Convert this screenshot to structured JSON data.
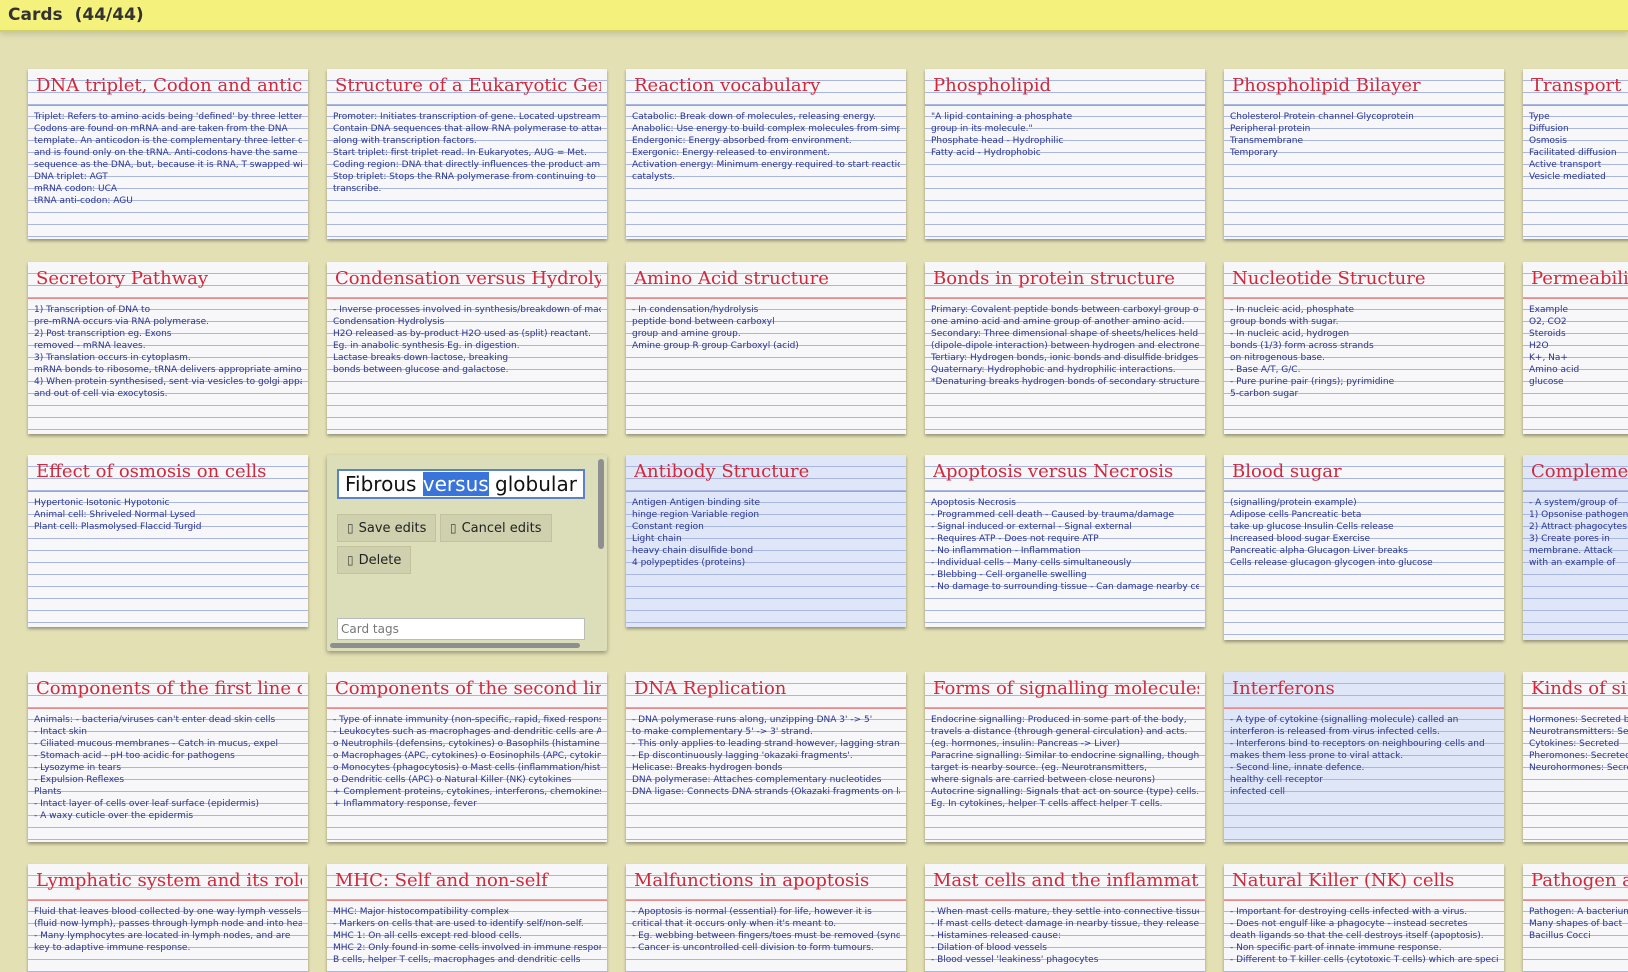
{
  "header": {
    "title": "Cards",
    "count": "(44/44)"
  },
  "editor": {
    "text_before": "Fibrous ",
    "text_selected": "versus",
    "text_after": " globular pro",
    "save_label": "Save edits",
    "cancel_label": "Cancel edits",
    "delete_label": "Delete",
    "tags_placeholder": "Card tags"
  },
  "cards": [
    {
      "title": "DNA triplet, Codon and anticodon",
      "lines": [
        "Triplet: Refers to amino acids being 'defined' by three letters.",
        "Codons are found on mRNA and are taken from the DNA",
        "template. An anticodon is the complementary three letter code",
        "and is found only on the tRNA. Anti-codons have the same",
        "sequence as the DNA, but, because it is RNA, T swapped with U.",
        "DNA triplet: AGT",
        "mRNA codon: UCA",
        "tRNA anti-codon: AGU"
      ]
    },
    {
      "title": "Structure of a Eukaryotic Gene",
      "lines": [
        "Promoter: Initiates transcription of gene. Located upstream.",
        "Contain DNA sequences that allow RNA polymerase to attach,",
        "along with transcription factors.",
        "Start triplet: first triplet read. In Eukaryotes, AUG = Met.",
        "Coding region: DNA that directly influences the product amino acids.",
        "Stop triplet: Stops the RNA polymerase from continuing to",
        "transcribe."
      ]
    },
    {
      "title": "Reaction vocabulary",
      "lines": [
        "Catabolic: Break down of molecules, releasing energy.",
        "Anabolic: Use energy to build complex molecules from simpler components.",
        "Endergonic: Energy absorbed from environment.",
        "Exergonic: Energy released to environment.",
        "Activation energy: Minimum energy required to start reaction. Lowered with",
        "catalysts."
      ]
    },
    {
      "title": "Phospholipid",
      "lines": [
        "\"A lipid containing a phosphate",
        "group in its molecule.\"",
        "Phosphate head - Hydrophilic",
        "Fatty acid - Hydrophobic"
      ]
    },
    {
      "title": "Phospholipid Bilayer",
      "lines": [
        "Cholesterol   Protein channel   Glycoprotein",
        "Peripheral protein",
        "Transmembrane",
        "Temporary"
      ]
    },
    {
      "title": "Transport across",
      "lines": [
        "Type",
        "Diffusion",
        "Osmosis",
        "Facilitated diffusion",
        "Active transport",
        "Vesicle mediated"
      ]
    },
    {
      "title": "Secretory Pathway",
      "lines": [
        "1) Transcription of DNA to",
        "pre-mRNA occurs via RNA polymerase.",
        "2) Post transcription eg. Exons",
        "removed - mRNA leaves.",
        "3) Translation occurs in cytoplasm.",
        "mRNA bonds to ribosome, tRNA delivers appropriate amino acids.",
        "4) When protein synthesised, sent via vesicles to golgi apparatus",
        "and out of cell via exocytosis."
      ]
    },
    {
      "title": "Condensation versus Hydrolysis",
      "lines": [
        "- Inverse processes involved in synthesis/breakdown of macromolecules.",
        "Condensation        Hydrolysis",
        "H2O released as by-product   H2O used as (split) reactant.",
        "Eg. in anabolic synthesis   Eg. in digestion.",
        "Lactase breaks down lactose, breaking",
        "bonds between glucose and galactose."
      ]
    },
    {
      "title": "Amino Acid structure",
      "lines": [
        "- In condensation/hydrolysis",
        "peptide bond between carboxyl",
        "group and amine group.",
        "Amine group   R group   Carboxyl (acid)"
      ]
    },
    {
      "title": "Bonds in protein structure",
      "lines": [
        "Primary: Covalent peptide bonds between carboxyl group of",
        "one amino acid and amine group of another amino acid.",
        "Secondary: Three dimensional shape of sheets/helices held by hydrogen bonds",
        "(dipole-dipole interaction) between hydrogen and electronegative atoms.",
        "Tertiary: Hydrogen bonds, ionic bonds and disulfide bridges.",
        "Quaternary: Hydrophobic and hydrophilic interactions.",
        "*Denaturing breaks hydrogen bonds of secondary structure."
      ]
    },
    {
      "title": "Nucleotide Structure",
      "lines": [
        "- In nucleic acid, phosphate",
        "group bonds with sugar.",
        "- In nucleic acid, hydrogen",
        "bonds (1/3) form across strands",
        "on nitrogenous base.",
        "- Base A/T, G/C.",
        "- Pure purine pair (rings); pyrimidine",
        "5-carbon sugar"
      ]
    },
    {
      "title": "Permeability of",
      "lines": [
        "Example",
        "O2, CO2",
        "Steroids",
        "H2O",
        "K+, Na+",
        "Amino acid",
        "glucose"
      ]
    },
    {
      "title": "Effect of osmosis on cells",
      "lines": [
        "Hypertonic      Isotonic      Hypotonic",
        "Animal cell: Shriveled   Normal   Lysed",
        "Plant cell: Plasmolysed   Flaccid   Turgid"
      ]
    },
    {
      "title": "Antibody Structure",
      "lines": [
        "Antigen     Antigen binding site",
        "hinge region     Variable region",
        "Constant region",
        "Light chain",
        "heavy chain     disulfide bond",
        "4 polypeptides (proteins)"
      ]
    },
    {
      "title": "Apoptosis versus Necrosis",
      "lines": [
        "Apoptosis           Necrosis",
        "- Programmed cell death   - Caused by trauma/damage",
        "- Signal induced or external   - Signal external",
        "- Requires ATP   - Does not require ATP",
        "- No inflammation   - Inflammation",
        "- Individual cells   - Many cells simultaneously",
        "- Blebbing   - Cell organelle swelling",
        "- No damage to surrounding tissue   - Can damage nearby cells"
      ]
    },
    {
      "title": "Blood sugar",
      "lines": [
        "(signalling/protein example)",
        "Adipose cells       Pancreatic beta",
        "take up glucose   Insulin   Cells release",
        "Increased blood sugar       Exercise",
        "Pancreatic alpha  Glucagon  Liver breaks",
        "Cells release glucagon  glycogen into glucose"
      ]
    },
    {
      "title": "Complement",
      "lines": [
        "- A system/group of",
        "1) Opsonise pathogen",
        "2) Attract phagocytes",
        "3) Create pores in",
        "membrane. Attack",
        "with an example of"
      ]
    },
    {
      "title": "Components of the first line of defence",
      "lines": [
        "Animals:   - bacteria/viruses can't enter dead skin cells",
        "- Intact skin",
        "- Ciliated mucous membranes - Catch in mucus, expel",
        "- Stomach acid - pH too acidic for pathogens",
        "- Lysozyme in tears",
        "- Expulsion Reflexes",
        "Plants",
        "- Intact layer of cells over leaf surface (epidermis)",
        "- A waxy cuticle over the epidermis"
      ]
    },
    {
      "title": "Components of the second line of defence",
      "lines": [
        "- Type of innate immunity (non-specific, rapid, fixed response, no mem)",
        "- Leukocytes such as macrophages and dendritic cells are APCs.",
        "o Neutrophils (defensins, cytokines)  o Basophils (histamine release)",
        "o Macrophages (APC, cytokines)   o Eosinophils (APC, cytokines)",
        "o Monocytes (phagocytosis)   o Mast cells (inflammation/histamine)",
        "o Dendritic cells (APC)   o Natural Killer (NK) cytokines",
        "+ Complement proteins, cytokines, interferons, chemokines",
        "+ Inflammatory response, fever"
      ]
    },
    {
      "title": "DNA Replication",
      "lines": [
        "- DNA polymerase runs along, unzipping DNA 3' -> 5'",
        "to make complementary 5' -> 3' strand.",
        "- This only applies to leading strand however, lagging strand",
        "- Ep discontinuously lagging 'okazaki fragments'.",
        "Helicase: Breaks hydrogen bonds",
        "DNA polymerase: Attaches complementary nucleotides",
        "DNA ligase: Connects DNA strands (Okazaki fragments on lagging)"
      ]
    },
    {
      "title": "Forms of signalling molecules",
      "lines": [
        "Endocrine signalling: Produced in some part of the body,",
        "travels a distance (through general circulation) and acts.",
        "(eg. hormones, insulin: Pancreas -> Liver)",
        "Paracrine signalling: Similar to endocrine signalling, though",
        "target is nearby source. (eg. Neurotransmitters,",
        "where signals are carried between close neurons)",
        "Autocrine signalling: Signals that act on source (type) cells.",
        "Eg. In cytokines, helper T cells affect helper T cells."
      ]
    },
    {
      "title": "Interferons",
      "lines": [
        "- A type of cytokine (signalling molecule) called an",
        "interferon is released from virus infected cells.",
        "- Interferons bind to receptors on neighbouring cells and",
        "makes them less prone to viral attack.",
        "- Second line, innate defence.",
        "healthy cell                receptor",
        "infected cell"
      ]
    },
    {
      "title": "Kinds of si",
      "lines": [
        "Hormones: Secreted by",
        "Neurotransmitters: Secreted",
        "Cytokines: Secreted",
        "Pheromones: Secreted",
        "Neurohormones: Secreted by"
      ]
    },
    {
      "title": "Lymphatic system and its role in immunity",
      "lines": [
        "Fluid that leaves blood collected by one way lymph vessels",
        "(fluid now lymph), passes through lymph node and into heart.",
        "- Many lymphocytes are located in lymph nodes, and are",
        "key to adaptive immune response."
      ]
    },
    {
      "title": "MHC: Self and non-self",
      "lines": [
        "MHC: Major histocompatibility complex",
        "- Markers on cells that are used to identify self/non-self.",
        "MHC 1: On all cells except red blood cells.",
        "MHC 2: Only found in some cells involved in immune response.",
        "B cells, helper T cells, macrophages and dendritic cells"
      ]
    },
    {
      "title": "Malfunctions in apoptosis",
      "lines": [
        "- Apoptosis is normal (essential) for life, however it is",
        "critical that it occurs only when it's meant to.",
        "- Eg. webbing between fingers/toes must be removed (syndactyly).",
        "- Cancer is uncontrolled cell division to form tumours."
      ]
    },
    {
      "title": "Mast cells and the inflammation response",
      "lines": [
        "- When mast cells mature, they settle into connective tissue by blood",
        "- If mast cells detect damage in nearby tissue, they release histamine.",
        "- Histamines released cause:",
        "- Dilation of blood vessels",
        "- Blood vessel 'leakiness'   phagocytes"
      ]
    },
    {
      "title": "Natural Killer (NK) cells",
      "lines": [
        "- Important for destroying cells infected with a virus.",
        "- Does not engulf like a phagocyte - instead secretes",
        "death ligands so that the cell destroys itself (apoptosis).",
        "- Non specific part of innate immune response.",
        "- Different to T killer cells (cytotoxic T cells) which are specific"
      ]
    },
    {
      "title": "Pathogen and",
      "lines": [
        "Pathogen: A bacterium",
        "Many shapes of bact",
        "Bacillus   Cocci"
      ]
    }
  ]
}
